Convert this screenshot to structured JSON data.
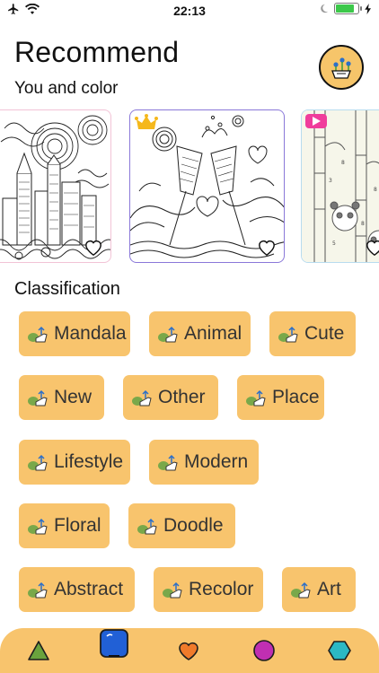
{
  "status": {
    "time": "22:13"
  },
  "header": {
    "title": "Recommend",
    "subtitle": "You and color"
  },
  "section": {
    "title": "Classification"
  },
  "categories": [
    {
      "label": "Mandala"
    },
    {
      "label": "Animal"
    },
    {
      "label": "Cute"
    },
    {
      "label": "New"
    },
    {
      "label": "Other"
    },
    {
      "label": "Place"
    },
    {
      "label": "Lifestyle"
    },
    {
      "label": "Modern"
    },
    {
      "label": "Floral"
    },
    {
      "label": "Doodle"
    },
    {
      "label": "Abstract"
    },
    {
      "label": "Recolor"
    },
    {
      "label": "Art"
    }
  ],
  "colors": {
    "accent": "#f8c46d",
    "battery": "#3cc84a",
    "card1_border": "#f2c3d6",
    "card2_border": "#8a78d9",
    "card3_border": "#b8dcef",
    "video_badge": "#f03d9c",
    "tab_triangle": "#6aa33d",
    "tab_square": "#2160d6",
    "tab_heart": "#f07a2a",
    "tab_circle": "#c02fb2",
    "tab_hexagon": "#2bb8c4"
  },
  "icons": {
    "status_left": [
      "airplane-icon",
      "wifi-icon"
    ],
    "status_right": [
      "moon-icon",
      "battery-icon",
      "charging-icon"
    ],
    "cards": [
      "heart-icon",
      "crown-icon",
      "video-badge-icon"
    ],
    "tabs": [
      "triangle-icon",
      "square-icon",
      "heart-icon",
      "circle-icon",
      "hexagon-icon"
    ]
  }
}
